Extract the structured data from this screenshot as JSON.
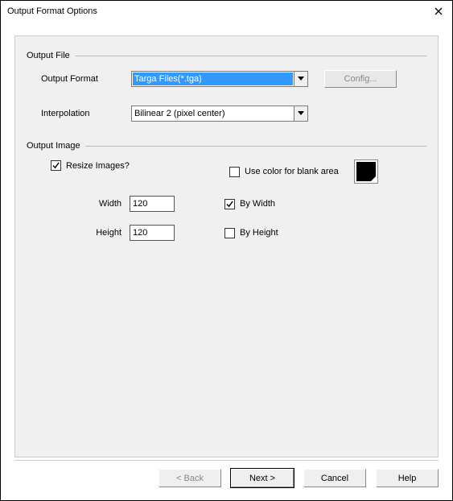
{
  "title": "Output Format Options",
  "sections": {
    "outputFile": {
      "header": "Output File",
      "formatLabel": "Output Format",
      "formatValue": "Targa Files(*.tga)",
      "configLabel": "Config...",
      "interpLabel": "Interpolation",
      "interpValue": "Bilinear 2 (pixel center)"
    },
    "outputImage": {
      "header": "Output Image",
      "resizeLabel": "Resize Images?",
      "resizeChecked": true,
      "blankLabel": "Use color for blank area",
      "blankChecked": false,
      "blankColor": "#000000",
      "widthLabel": "Width",
      "widthValue": "120",
      "heightLabel": "Height",
      "heightValue": "120",
      "byWidthLabel": "By Width",
      "byWidthChecked": true,
      "byHeightLabel": "By Height",
      "byHeightChecked": false
    }
  },
  "buttons": {
    "back": "< Back",
    "next": "Next >",
    "cancel": "Cancel",
    "help": "Help"
  }
}
